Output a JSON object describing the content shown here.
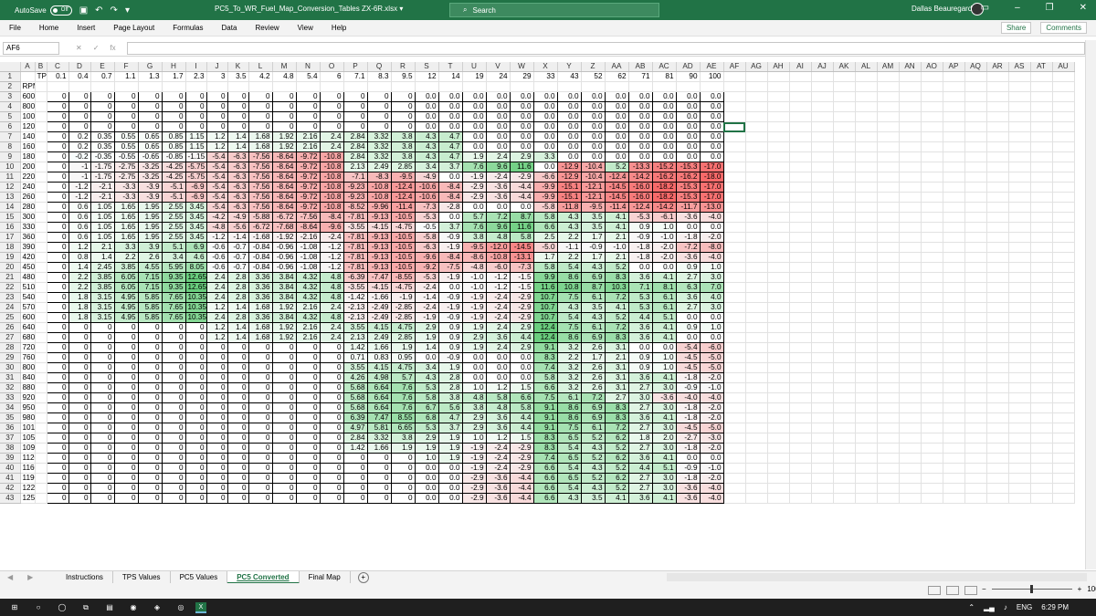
{
  "titlebar": {
    "autosave_label": "AutoSave",
    "autosave_state": "Off",
    "filename": "PC5_To_WR_Fuel_Map_Conversion_Tables ZX-6R.xlsx",
    "search_placeholder": "Search",
    "user": "Dallas Beauregard"
  },
  "menu": {
    "items": [
      "File",
      "Home",
      "Insert",
      "Page Layout",
      "Formulas",
      "Data",
      "Review",
      "View",
      "Help"
    ],
    "share": "Share",
    "comments": "Comments"
  },
  "formula": {
    "namebox": "AF6",
    "fx": "fx"
  },
  "columns": [
    "A",
    "B",
    "C",
    "D",
    "E",
    "F",
    "G",
    "H",
    "I",
    "J",
    "K",
    "L",
    "M",
    "N",
    "O",
    "P",
    "Q",
    "R",
    "S",
    "T",
    "U",
    "V",
    "W",
    "X",
    "Y",
    "Z",
    "AA",
    "AB",
    "AC",
    "AD",
    "AE",
    "AF",
    "AG",
    "AH",
    "AI",
    "AJ",
    "AK",
    "AL",
    "AM",
    "AN",
    "AO",
    "AP",
    "AQ",
    "AR",
    "AS",
    "AT",
    "AU"
  ],
  "selected_col": "AF",
  "selected_row": 6,
  "tps_label": "TPS",
  "rpm_label": "RPM",
  "tps": [
    "0.1",
    "0.4",
    "0.7",
    "1.1",
    "1.3",
    "1.7",
    "2.3",
    "3",
    "3.5",
    "4.2",
    "4.8",
    "5.4",
    "6",
    "7.1",
    "8.3",
    "9.5",
    "12",
    "14",
    "19",
    "24",
    "29",
    "33",
    "43",
    "52",
    "62",
    "71",
    "81",
    "90",
    "100"
  ],
  "rows": [
    [
      "600",
      "0",
      "0",
      "0",
      "0",
      "0",
      "0",
      "0",
      "0",
      "0",
      "0",
      "0",
      "0",
      "0",
      "0",
      "0",
      "0",
      "0.0",
      "0.0",
      "0.0",
      "0.0",
      "0.0",
      "0.0",
      "0.0",
      "0.0",
      "0.0",
      "0.0",
      "0.0",
      "0.0",
      "0.0"
    ],
    [
      "800",
      "0",
      "0",
      "0",
      "0",
      "0",
      "0",
      "0",
      "0",
      "0",
      "0",
      "0",
      "0",
      "0",
      "0",
      "0",
      "0",
      "0.0",
      "0.0",
      "0.0",
      "0.0",
      "0.0",
      "0.0",
      "0.0",
      "0.0",
      "0.0",
      "0.0",
      "0.0",
      "0.0",
      "0.0"
    ],
    [
      "1000",
      "0",
      "0",
      "0",
      "0",
      "0",
      "0",
      "0",
      "0",
      "0",
      "0",
      "0",
      "0",
      "0",
      "0",
      "0",
      "0",
      "0.0",
      "0.0",
      "0.0",
      "0.0",
      "0.0",
      "0.0",
      "0.0",
      "0.0",
      "0.0",
      "0.0",
      "0.0",
      "0.0",
      "0.0"
    ],
    [
      "1200",
      "0",
      "0",
      "0",
      "0",
      "0",
      "0",
      "0",
      "0",
      "0",
      "0",
      "0",
      "0",
      "0",
      "0",
      "0",
      "0",
      "0.0",
      "0.0",
      "0.0",
      "0.0",
      "0.0",
      "0.0",
      "0.0",
      "0.0",
      "0.0",
      "0.0",
      "0.0",
      "0.0",
      "0.0"
    ],
    [
      "1400",
      "0",
      "0.2",
      "0.35",
      "0.55",
      "0.65",
      "0.85",
      "1.15",
      "1.2",
      "1.4",
      "1.68",
      "1.92",
      "2.16",
      "2.4",
      "2.84",
      "3.32",
      "3.8",
      "4.3",
      "4.7",
      "0.0",
      "0.0",
      "0.0",
      "0.0",
      "0.0",
      "0.0",
      "0.0",
      "0.0",
      "0.0",
      "0.0",
      "0.0"
    ],
    [
      "1600",
      "0",
      "0.2",
      "0.35",
      "0.55",
      "0.65",
      "0.85",
      "1.15",
      "1.2",
      "1.4",
      "1.68",
      "1.92",
      "2.16",
      "2.4",
      "2.84",
      "3.32",
      "3.8",
      "4.3",
      "4.7",
      "0.0",
      "0.0",
      "0.0",
      "0.0",
      "0.0",
      "0.0",
      "0.0",
      "0.0",
      "0.0",
      "0.0",
      "0.0"
    ],
    [
      "1800",
      "0",
      "-0.2",
      "-0.35",
      "-0.55",
      "-0.65",
      "-0.85",
      "-1.15",
      "-5.4",
      "-6.3",
      "-7.56",
      "-8.64",
      "-9.72",
      "-10.8",
      "2.84",
      "3.32",
      "3.8",
      "4.3",
      "4.7",
      "1.9",
      "2.4",
      "2.9",
      "3.3",
      "0.0",
      "0.0",
      "0.0",
      "0.0",
      "0.0",
      "0.0",
      "0.0"
    ],
    [
      "2000",
      "0",
      "-1",
      "-1.75",
      "-2.75",
      "-3.25",
      "-4.25",
      "-5.75",
      "-5.4",
      "-6.3",
      "-7.56",
      "-8.64",
      "-9.72",
      "-10.8",
      "2.13",
      "2.49",
      "2.85",
      "3.4",
      "3.7",
      "7.6",
      "9.6",
      "11.6",
      "0.0",
      "-12.9",
      "-10.4",
      "5.2",
      "-13.3",
      "-15.2",
      "-15.3",
      "-17.0"
    ],
    [
      "2200",
      "0",
      "-1",
      "-1.75",
      "-2.75",
      "-3.25",
      "-4.25",
      "-5.75",
      "-5.4",
      "-6.3",
      "-7.56",
      "-8.64",
      "-9.72",
      "-10.8",
      "-7.1",
      "-8.3",
      "-9.5",
      "-4.9",
      "0.0",
      "-1.9",
      "-2.4",
      "-2.9",
      "-6.6",
      "-12.9",
      "-10.4",
      "-12.4",
      "-14.2",
      "-16.2",
      "-16.2",
      "-18.0"
    ],
    [
      "2400",
      "0",
      "-1.2",
      "-2.1",
      "-3.3",
      "-3.9",
      "-5.1",
      "-6.9",
      "-5.4",
      "-6.3",
      "-7.56",
      "-8.64",
      "-9.72",
      "-10.8",
      "-9.23",
      "-10.8",
      "-12.4",
      "-10.6",
      "-8.4",
      "-2.9",
      "-3.6",
      "-4.4",
      "-9.9",
      "-15.1",
      "-12.1",
      "-14.5",
      "-16.0",
      "-18.2",
      "-15.3",
      "-17.0"
    ],
    [
      "2600",
      "0",
      "-1.2",
      "-2.1",
      "-3.3",
      "-3.9",
      "-5.1",
      "-6.9",
      "-5.4",
      "-6.3",
      "-7.56",
      "-8.64",
      "-9.72",
      "-10.8",
      "-9.23",
      "-10.8",
      "-12.4",
      "-10.6",
      "-8.4",
      "-2.9",
      "-3.6",
      "-4.4",
      "-9.9",
      "-15.1",
      "-12.1",
      "-14.5",
      "-16.0",
      "-18.2",
      "-15.3",
      "-17.0"
    ],
    [
      "2800",
      "0",
      "0.6",
      "1.05",
      "1.65",
      "1.95",
      "2.55",
      "3.45",
      "-5.4",
      "-6.3",
      "-7.56",
      "-8.64",
      "-9.72",
      "-10.8",
      "-8.52",
      "-9.96",
      "-11.4",
      "-7.3",
      "-2.8",
      "0.0",
      "0.0",
      "0.0",
      "-5.8",
      "-11.8",
      "-9.5",
      "-11.4",
      "-12.4",
      "-14.2",
      "-11.7",
      "-13.0"
    ],
    [
      "3000",
      "0",
      "0.6",
      "1.05",
      "1.65",
      "1.95",
      "2.55",
      "3.45",
      "-4.2",
      "-4.9",
      "-5.88",
      "-6.72",
      "-7.56",
      "-8.4",
      "-7.81",
      "-9.13",
      "-10.5",
      "-5.3",
      "0.0",
      "5.7",
      "7.2",
      "8.7",
      "5.8",
      "4.3",
      "3.5",
      "4.1",
      "-5.3",
      "-6.1",
      "-3.6",
      "-4.0"
    ],
    [
      "3300",
      "0",
      "0.6",
      "1.05",
      "1.65",
      "1.95",
      "2.55",
      "3.45",
      "-4.8",
      "-5.6",
      "-6.72",
      "-7.68",
      "-8.64",
      "-9.6",
      "-3.55",
      "-4.15",
      "-4.75",
      "-0.5",
      "3.7",
      "7.6",
      "9.6",
      "11.6",
      "6.6",
      "4.3",
      "3.5",
      "4.1",
      "0.9",
      "1.0",
      "0.0",
      "0.0"
    ],
    [
      "3600",
      "0",
      "0.6",
      "1.05",
      "1.65",
      "1.95",
      "2.55",
      "3.45",
      "-1.2",
      "-1.4",
      "-1.68",
      "-1.92",
      "-2.16",
      "-2.4",
      "-7.81",
      "-9.13",
      "-10.5",
      "-5.8",
      "-0.9",
      "3.8",
      "4.8",
      "5.8",
      "2.5",
      "2.2",
      "1.7",
      "2.1",
      "-0.9",
      "-1.0",
      "-1.8",
      "-2.0"
    ],
    [
      "3900",
      "0",
      "1.2",
      "2.1",
      "3.3",
      "3.9",
      "5.1",
      "6.9",
      "-0.6",
      "-0.7",
      "-0.84",
      "-0.96",
      "-1.08",
      "-1.2",
      "-7.81",
      "-9.13",
      "-10.5",
      "-6.3",
      "-1.9",
      "-9.5",
      "-12.0",
      "-14.5",
      "-5.0",
      "-1.1",
      "-0.9",
      "-1.0",
      "-1.8",
      "-2.0",
      "-7.2",
      "-8.0"
    ],
    [
      "4200",
      "0",
      "0.8",
      "1.4",
      "2.2",
      "2.6",
      "3.4",
      "4.6",
      "-0.6",
      "-0.7",
      "-0.84",
      "-0.96",
      "-1.08",
      "-1.2",
      "-7.81",
      "-9.13",
      "-10.5",
      "-9.6",
      "-8.4",
      "-8.6",
      "-10.8",
      "-13.1",
      "1.7",
      "2.2",
      "1.7",
      "2.1",
      "-1.8",
      "-2.0",
      "-3.6",
      "-4.0"
    ],
    [
      "4500",
      "0",
      "1.4",
      "2.45",
      "3.85",
      "4.55",
      "5.95",
      "8.05",
      "-0.6",
      "-0.7",
      "-0.84",
      "-0.96",
      "-1.08",
      "-1.2",
      "-7.81",
      "-9.13",
      "-10.5",
      "-9.2",
      "-7.5",
      "-4.8",
      "-6.0",
      "-7.3",
      "5.8",
      "5.4",
      "4.3",
      "5.2",
      "0.0",
      "0.0",
      "0.9",
      "1.0"
    ],
    [
      "4800",
      "0",
      "2.2",
      "3.85",
      "6.05",
      "7.15",
      "9.35",
      "12.65",
      "2.4",
      "2.8",
      "3.36",
      "3.84",
      "4.32",
      "4.8",
      "-6.39",
      "-7.47",
      "-8.55",
      "-5.3",
      "-1.9",
      "-1.0",
      "-1.2",
      "-1.5",
      "9.9",
      "8.6",
      "6.9",
      "8.3",
      "3.6",
      "4.1",
      "2.7",
      "3.0"
    ],
    [
      "5100",
      "0",
      "2.2",
      "3.85",
      "6.05",
      "7.15",
      "9.35",
      "12.65",
      "2.4",
      "2.8",
      "3.36",
      "3.84",
      "4.32",
      "4.8",
      "-3.55",
      "-4.15",
      "-4.75",
      "-2.4",
      "0.0",
      "-1.0",
      "-1.2",
      "-1.5",
      "11.6",
      "10.8",
      "8.7",
      "10.3",
      "7.1",
      "8.1",
      "6.3",
      "7.0"
    ],
    [
      "5400",
      "0",
      "1.8",
      "3.15",
      "4.95",
      "5.85",
      "7.65",
      "10.35",
      "2.4",
      "2.8",
      "3.36",
      "3.84",
      "4.32",
      "4.8",
      "-1.42",
      "-1.66",
      "-1.9",
      "-1.4",
      "-0.9",
      "-1.9",
      "-2.4",
      "-2.9",
      "10.7",
      "7.5",
      "6.1",
      "7.2",
      "5.3",
      "6.1",
      "3.6",
      "4.0"
    ],
    [
      "5700",
      "0",
      "1.8",
      "3.15",
      "4.95",
      "5.85",
      "7.65",
      "10.35",
      "1.2",
      "1.4",
      "1.68",
      "1.92",
      "2.16",
      "2.4",
      "-2.13",
      "-2.49",
      "-2.85",
      "-2.4",
      "-1.9",
      "-1.9",
      "-2.4",
      "-2.9",
      "10.7",
      "4.3",
      "3.5",
      "4.1",
      "5.3",
      "6.1",
      "2.7",
      "3.0"
    ],
    [
      "6000",
      "0",
      "1.8",
      "3.15",
      "4.95",
      "5.85",
      "7.65",
      "10.35",
      "2.4",
      "2.8",
      "3.36",
      "3.84",
      "4.32",
      "4.8",
      "-2.13",
      "-2.49",
      "-2.85",
      "-1.9",
      "-0.9",
      "-1.9",
      "-2.4",
      "-2.9",
      "10.7",
      "5.4",
      "4.3",
      "5.2",
      "4.4",
      "5.1",
      "0.0",
      "0.0"
    ],
    [
      "6400",
      "0",
      "0",
      "0",
      "0",
      "0",
      "0",
      "0",
      "1.2",
      "1.4",
      "1.68",
      "1.92",
      "2.16",
      "2.4",
      "3.55",
      "4.15",
      "4.75",
      "2.9",
      "0.9",
      "1.9",
      "2.4",
      "2.9",
      "12.4",
      "7.5",
      "6.1",
      "7.2",
      "3.6",
      "4.1",
      "0.9",
      "1.0"
    ],
    [
      "6800",
      "0",
      "0",
      "0",
      "0",
      "0",
      "0",
      "0",
      "1.2",
      "1.4",
      "1.68",
      "1.92",
      "2.16",
      "2.4",
      "2.13",
      "2.49",
      "2.85",
      "1.9",
      "0.9",
      "2.9",
      "3.6",
      "4.4",
      "12.4",
      "8.6",
      "6.9",
      "8.3",
      "3.6",
      "4.1",
      "0.0",
      "0.0"
    ],
    [
      "7200",
      "0",
      "0",
      "0",
      "0",
      "0",
      "0",
      "0",
      "0",
      "0",
      "0",
      "0",
      "0",
      "0",
      "1.42",
      "1.66",
      "1.9",
      "1.4",
      "0.9",
      "1.9",
      "2.4",
      "2.9",
      "9.1",
      "3.2",
      "2.6",
      "3.1",
      "0.0",
      "0.0",
      "-5.4",
      "-6.0"
    ],
    [
      "7600",
      "0",
      "0",
      "0",
      "0",
      "0",
      "0",
      "0",
      "0",
      "0",
      "0",
      "0",
      "0",
      "0",
      "0.71",
      "0.83",
      "0.95",
      "0.0",
      "-0.9",
      "0.0",
      "0.0",
      "0.0",
      "8.3",
      "2.2",
      "1.7",
      "2.1",
      "0.9",
      "1.0",
      "-4.5",
      "-5.0"
    ],
    [
      "8000",
      "0",
      "0",
      "0",
      "0",
      "0",
      "0",
      "0",
      "0",
      "0",
      "0",
      "0",
      "0",
      "0",
      "3.55",
      "4.15",
      "4.75",
      "3.4",
      "1.9",
      "0.0",
      "0.0",
      "0.0",
      "7.4",
      "3.2",
      "2.6",
      "3.1",
      "0.9",
      "1.0",
      "-4.5",
      "-5.0"
    ],
    [
      "8400",
      "0",
      "0",
      "0",
      "0",
      "0",
      "0",
      "0",
      "0",
      "0",
      "0",
      "0",
      "0",
      "0",
      "4.26",
      "4.98",
      "5.7",
      "4.3",
      "2.8",
      "0.0",
      "0.0",
      "0.0",
      "5.8",
      "3.2",
      "2.6",
      "3.1",
      "3.6",
      "4.1",
      "-1.8",
      "-2.0"
    ],
    [
      "8800",
      "0",
      "0",
      "0",
      "0",
      "0",
      "0",
      "0",
      "0",
      "0",
      "0",
      "0",
      "0",
      "0",
      "5.68",
      "6.64",
      "7.6",
      "5.3",
      "2.8",
      "1.0",
      "1.2",
      "1.5",
      "6.6",
      "3.2",
      "2.6",
      "3.1",
      "2.7",
      "3.0",
      "-0.9",
      "-1.0"
    ],
    [
      "9200",
      "0",
      "0",
      "0",
      "0",
      "0",
      "0",
      "0",
      "0",
      "0",
      "0",
      "0",
      "0",
      "0",
      "5.68",
      "6.64",
      "7.6",
      "5.8",
      "3.8",
      "4.8",
      "5.8",
      "6.6",
      "7.5",
      "6.1",
      "7.2",
      "2.7",
      "3.0",
      "-3.6",
      "-4.0",
      "-4.0"
    ],
    [
      "9500",
      "0",
      "0",
      "0",
      "0",
      "0",
      "0",
      "0",
      "0",
      "0",
      "0",
      "0",
      "0",
      "0",
      "5.68",
      "6.64",
      "7.6",
      "6.7",
      "5.6",
      "3.8",
      "4.8",
      "5.8",
      "9.1",
      "8.6",
      "6.9",
      "8.3",
      "2.7",
      "3.0",
      "-1.8",
      "-2.0"
    ],
    [
      "9800",
      "0",
      "0",
      "0",
      "0",
      "0",
      "0",
      "0",
      "0",
      "0",
      "0",
      "0",
      "0",
      "0",
      "6.39",
      "7.47",
      "8.55",
      "6.8",
      "4.7",
      "2.9",
      "3.6",
      "4.4",
      "9.1",
      "8.6",
      "6.9",
      "8.3",
      "3.6",
      "4.1",
      "-1.8",
      "-2.0"
    ],
    [
      "10100",
      "0",
      "0",
      "0",
      "0",
      "0",
      "0",
      "0",
      "0",
      "0",
      "0",
      "0",
      "0",
      "0",
      "4.97",
      "5.81",
      "6.65",
      "5.3",
      "3.7",
      "2.9",
      "3.6",
      "4.4",
      "9.1",
      "7.5",
      "6.1",
      "7.2",
      "2.7",
      "3.0",
      "-4.5",
      "-5.0"
    ],
    [
      "10500",
      "0",
      "0",
      "0",
      "0",
      "0",
      "0",
      "0",
      "0",
      "0",
      "0",
      "0",
      "0",
      "0",
      "2.84",
      "3.32",
      "3.8",
      "2.9",
      "1.9",
      "1.0",
      "1.2",
      "1.5",
      "8.3",
      "6.5",
      "5.2",
      "6.2",
      "1.8",
      "2.0",
      "-2.7",
      "-3.0"
    ],
    [
      "10900",
      "0",
      "0",
      "0",
      "0",
      "0",
      "0",
      "0",
      "0",
      "0",
      "0",
      "0",
      "0",
      "0",
      "1.42",
      "1.66",
      "1.9",
      "1.9",
      "1.9",
      "-1.9",
      "-2.4",
      "-2.9",
      "8.3",
      "5.4",
      "4.3",
      "5.2",
      "2.7",
      "3.0",
      "-1.8",
      "-2.0"
    ],
    [
      "11200",
      "0",
      "0",
      "0",
      "0",
      "0",
      "0",
      "0",
      "0",
      "0",
      "0",
      "0",
      "0",
      "0",
      "0",
      "0",
      "0",
      "1.0",
      "1.9",
      "-1.9",
      "-2.4",
      "-2.9",
      "7.4",
      "6.5",
      "5.2",
      "6.2",
      "3.6",
      "4.1",
      "0.0",
      "0.0"
    ],
    [
      "11600",
      "0",
      "0",
      "0",
      "0",
      "0",
      "0",
      "0",
      "0",
      "0",
      "0",
      "0",
      "0",
      "0",
      "0",
      "0",
      "0",
      "0.0",
      "0.0",
      "-1.9",
      "-2.4",
      "-2.9",
      "6.6",
      "5.4",
      "4.3",
      "5.2",
      "4.4",
      "5.1",
      "-0.9",
      "-1.0"
    ],
    [
      "11900",
      "0",
      "0",
      "0",
      "0",
      "0",
      "0",
      "0",
      "0",
      "0",
      "0",
      "0",
      "0",
      "0",
      "0",
      "0",
      "0",
      "0.0",
      "0.0",
      "-2.9",
      "-3.6",
      "-4.4",
      "6.6",
      "6.5",
      "5.2",
      "6.2",
      "2.7",
      "3.0",
      "-1.8",
      "-2.0"
    ],
    [
      "12200",
      "0",
      "0",
      "0",
      "0",
      "0",
      "0",
      "0",
      "0",
      "0",
      "0",
      "0",
      "0",
      "0",
      "0",
      "0",
      "0",
      "0.0",
      "0.0",
      "-2.9",
      "-3.6",
      "-4.4",
      "6.6",
      "5.4",
      "4.3",
      "5.2",
      "2.7",
      "3.0",
      "-3.6",
      "-4.0"
    ],
    [
      "12500",
      "0",
      "0",
      "0",
      "0",
      "0",
      "0",
      "0",
      "0",
      "0",
      "0",
      "0",
      "0",
      "0",
      "0",
      "0",
      "0",
      "0.0",
      "0.0",
      "-2.9",
      "-3.6",
      "-4.4",
      "6.6",
      "4.3",
      "3.5",
      "4.1",
      "3.6",
      "4.1",
      "-3.6",
      "-4.0"
    ]
  ],
  "tabs": [
    "Instructions",
    "TPS Values",
    "PC5 Values",
    "PC5 Converted",
    "Final Map"
  ],
  "active_tab": "PC5 Converted",
  "status": {
    "zoom": "100%"
  },
  "taskbar": {
    "lang": "ENG",
    "time": "6:29 PM"
  }
}
